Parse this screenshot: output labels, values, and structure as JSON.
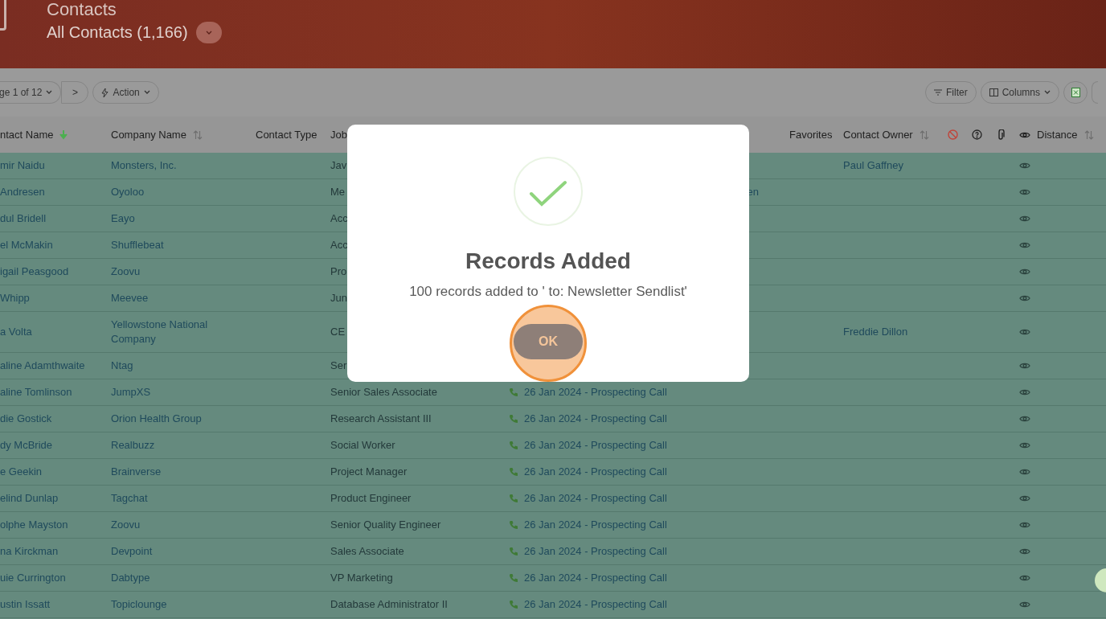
{
  "header": {
    "title": "Contacts",
    "subtitle": "All Contacts (1,166)"
  },
  "toolbar": {
    "pager": "ge 1 of 12",
    "next": ">",
    "action": "Action",
    "filter": "Filter",
    "columns": "Columns"
  },
  "table": {
    "columns": [
      {
        "kind": "text",
        "label": "ntact Name",
        "sorted": true
      },
      {
        "kind": "text",
        "label": "Company Name",
        "sorted": false
      },
      {
        "kind": "text",
        "label": "Contact Type"
      },
      {
        "kind": "text",
        "label": "Job"
      },
      {
        "kind": "blank"
      },
      {
        "kind": "text",
        "label": "Favorites"
      },
      {
        "kind": "text",
        "label": "Contact Owner",
        "sorted": false
      },
      {
        "kind": "icon"
      },
      {
        "kind": "icon"
      },
      {
        "kind": "icon"
      },
      {
        "kind": "icon"
      },
      {
        "kind": "text",
        "label": "Distance",
        "sorted": false
      }
    ],
    "rows": [
      {
        "name": "mir Naidu",
        "company": "Monsters, Inc.",
        "job": "Jav",
        "owner": "Paul Gaffney"
      },
      {
        "name": " Andresen",
        "company": "Oyoloo",
        "job": "Me",
        "fragment": "en"
      },
      {
        "name": "dul Bridell",
        "company": "Eayo",
        "job": "Acc"
      },
      {
        "name": "el McMakin",
        "company": "Shufflebeat",
        "job": "Acc"
      },
      {
        "name": "igail Peasgood",
        "company": "Zoovu",
        "job": "Pro"
      },
      {
        "name": " Whipp",
        "company": "Meevee",
        "job": "Jun"
      },
      {
        "name": "a Volta",
        "company": "Yellowstone National Company",
        "job": "CE",
        "owner": "Freddie Dillon"
      },
      {
        "name": "aline Adamthwaite",
        "company": "Ntag",
        "job": "Ser"
      },
      {
        "name": "aline Tomlinson",
        "company": "JumpXS",
        "job": "Senior Sales Associate",
        "activity": "26 Jan 2024 - Prospecting Call"
      },
      {
        "name": "die Gostick",
        "company": "Orion Health Group",
        "job": "Research Assistant III",
        "activity": "26 Jan 2024 - Prospecting Call"
      },
      {
        "name": "dy McBride",
        "company": "Realbuzz",
        "job": "Social Worker",
        "activity": "26 Jan 2024 - Prospecting Call"
      },
      {
        "name": "e Geekin",
        "company": "Brainverse",
        "job": "Project Manager",
        "activity": "26 Jan 2024 - Prospecting Call"
      },
      {
        "name": "elind Dunlap",
        "company": "Tagchat",
        "job": "Product Engineer",
        "activity": "26 Jan 2024 - Prospecting Call"
      },
      {
        "name": "olphe Mayston",
        "company": "Zoovu",
        "job": "Senior Quality Engineer",
        "activity": "26 Jan 2024 - Prospecting Call"
      },
      {
        "name": "na Kirckman",
        "company": "Devpoint",
        "job": "Sales Associate",
        "activity": "26 Jan 2024 - Prospecting Call"
      },
      {
        "name": "uie Currington",
        "company": "Dabtype",
        "job": "VP Marketing",
        "activity": "26 Jan 2024 - Prospecting Call"
      },
      {
        "name": "ustin Issatt",
        "company": "Topiclounge",
        "job": "Database Administrator II",
        "activity": "26 Jan 2024 - Prospecting Call"
      }
    ]
  },
  "modal": {
    "title": "Records Added",
    "message": "100 records added to ' to: Newsletter Sendlist'",
    "button": "OK",
    "highlighted": true
  }
}
